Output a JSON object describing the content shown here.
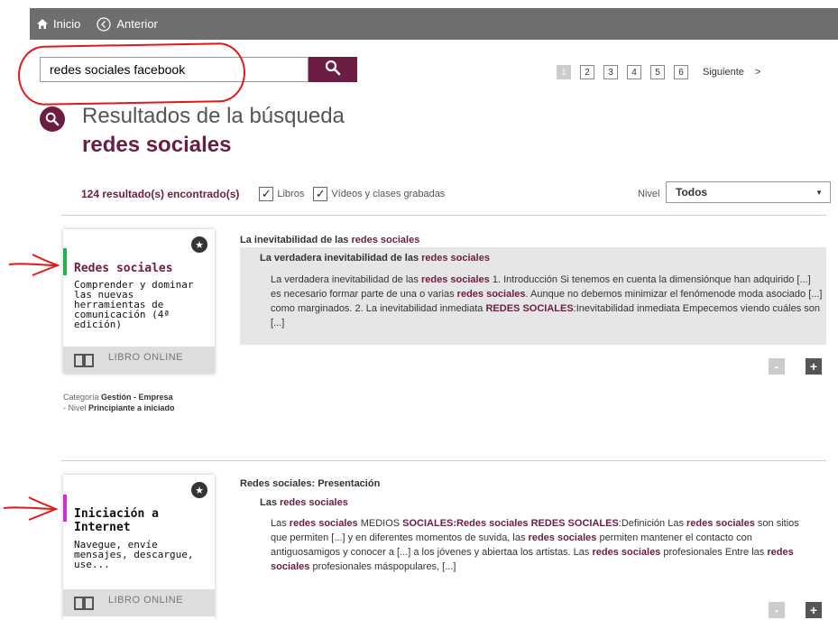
{
  "nav": {
    "home_label": "Inicio",
    "back_label": "Anterior"
  },
  "search": {
    "value": "redes sociales facebook"
  },
  "pagination": {
    "pages": [
      "1",
      "2",
      "3",
      "4",
      "5",
      "6"
    ],
    "active": "1",
    "next_label": "Siguiente",
    "chevron": ">"
  },
  "results": {
    "heading": "Resultados de la búsqueda",
    "query": "redes sociales",
    "count_text": "124 resultado(s) encontrado(s)"
  },
  "filters": {
    "libros_label": "Libros",
    "libros_checked": true,
    "videos_label": "Vídeos y clases grabadas",
    "videos_checked": true,
    "nivel_label": "Nivel",
    "nivel_value": "Todos"
  },
  "items": [
    {
      "card": {
        "title": "Redes sociales",
        "subtitle": "Comprender y dominar las nuevas herramientas de comunicación (4ª edición)",
        "type_label": "LIBRO ONLINE",
        "accent_color": "#22b14c"
      },
      "meta": {
        "categoria_label": "Categoría",
        "categoria": "Gestión - Empresa",
        "nivel_label": "- Nivel",
        "nivel": "Principiante a iniciado"
      },
      "title_prefix": "La inevitabilidad de las ",
      "title_hl": "redes sociales",
      "sub_prefix": "La verdadera inevitabilidad de las ",
      "sub_hl": "redes sociales",
      "body_parts": [
        {
          "t": "La verdadera inevitabilidad de las "
        },
        {
          "h": "redes sociales"
        },
        {
          "t": " 1. Introducción Si tenemos en cuenta la dimensiónque han adquirido [...] es necesario formar parte de una o varias "
        },
        {
          "h": "redes sociales"
        },
        {
          "t": ". Aunque no debemos minimizar el fenómenode moda asociado [...] como marginados. 2. La inevitabilidad inmediata "
        },
        {
          "h": "REDES SOCIALES"
        },
        {
          "t": ":Inevitabilidad inmediata Empecemos viendo cuáles son [...]"
        }
      ]
    },
    {
      "card": {
        "title": "Iniciación a Internet",
        "subtitle": "Navegue, envíe mensajes, descargue, use...",
        "type_label": "LIBRO ONLINE",
        "accent_color": "#cc33cc"
      },
      "title_prefix": "Redes sociales: Presentación",
      "title_hl": "",
      "sub_prefix": "Las ",
      "sub_hl": "redes sociales",
      "body_parts": [
        {
          "t": "Las "
        },
        {
          "h": "redes sociales"
        },
        {
          "t": " MEDIOS "
        },
        {
          "h": "SOCIALES:Redes sociales REDES SOCIALES"
        },
        {
          "t": ":Definición Las "
        },
        {
          "h": "redes sociales"
        },
        {
          "t": " son sitios que permiten [...] y en diferentes momentos de suvida, las "
        },
        {
          "h": "redes sociales"
        },
        {
          "t": " permiten mantener el contacto con antiguosamigos y conocer a [...] a los jóvenes y abiertaa los artistas. Las "
        },
        {
          "h": "redes sociales"
        },
        {
          "t": " profesionales Entre las "
        },
        {
          "h": "redes sociales"
        },
        {
          "t": " profesionales máspopulares, [...]"
        }
      ]
    }
  ],
  "buttons": {
    "minus": "-",
    "plus": "+"
  },
  "colors": {
    "brand": "#6b1d43",
    "annotation": "#e01a1a"
  },
  "icons": [
    "home-icon",
    "back-circle-icon",
    "search-icon",
    "star-icon",
    "book-icon",
    "check-icon"
  ]
}
